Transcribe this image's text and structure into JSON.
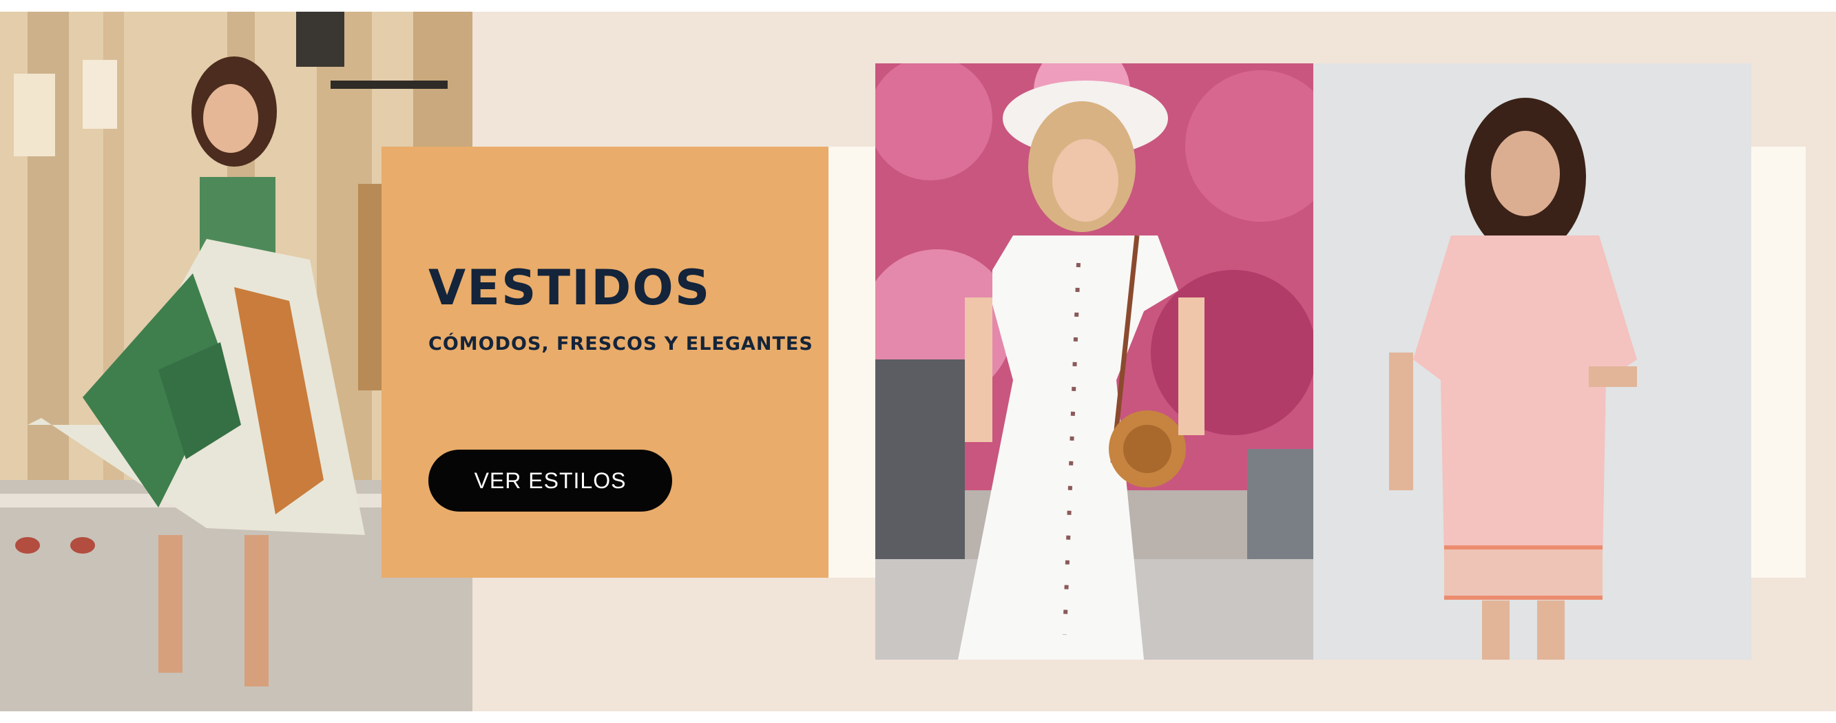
{
  "promo": {
    "title": "VESTIDOS",
    "subtitle": "CÓMODOS, FRESCOS Y ELEGANTES",
    "cta_label": "VER ESTILOS"
  },
  "colors": {
    "banner_background": "#f1e4d9",
    "cream_band": "#fdf8ef",
    "card_background": "#e9ac6a",
    "title_color": "#14243a",
    "cta_background": "#050505",
    "cta_text": "#ffffff"
  }
}
